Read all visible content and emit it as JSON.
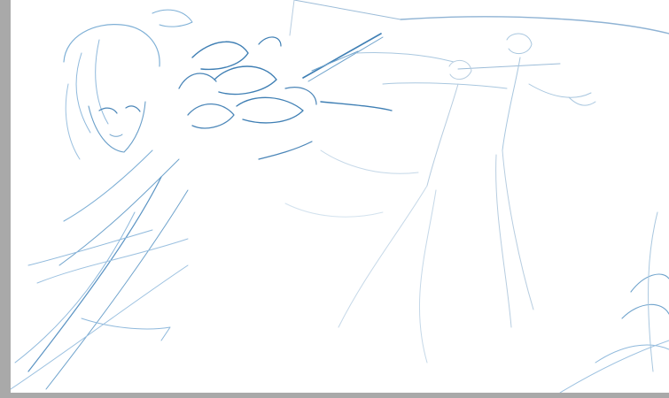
{
  "scene": {
    "description_icon": "sketch-canvas-icon",
    "colors": {
      "workspace": "#a9a9a9",
      "paper": "#ffffff",
      "stroke_dark": "#3f7fb4",
      "stroke_mid": "#6fa3cc",
      "stroke_light": "#a9c7df",
      "stroke_faint": "#d3e2ee"
    }
  }
}
